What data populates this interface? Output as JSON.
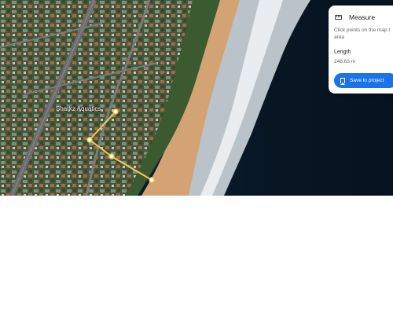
{
  "map": {
    "place_label": "Sharkz Aquatics"
  },
  "measure_panel": {
    "title": "Measure",
    "hint_line1": "Click points on the map t",
    "hint_line2": "area",
    "length_label": "Length",
    "length_value": "248.63 m",
    "save_button_label": "Save to project",
    "icon": "ruler-icon",
    "save_icon": "bookmark-icon"
  },
  "colors": {
    "measure_line": "#f2c94c",
    "button": "#1a73e8",
    "ocean": "#06121f",
    "sand": "#d4a373"
  }
}
